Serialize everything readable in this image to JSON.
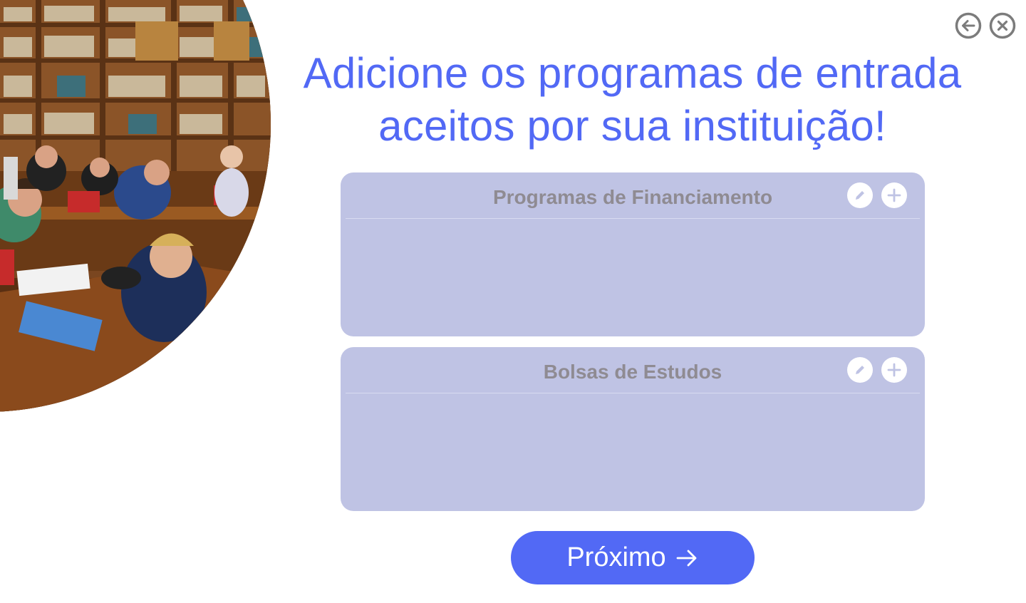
{
  "header": {
    "back_icon": "arrow-left-circle-icon",
    "close_icon": "close-circle-icon"
  },
  "hero_image": {
    "subject": "library-photo"
  },
  "title": {
    "line1": "Adicione os programas de entrada",
    "line2": "aceitos por sua instituição!"
  },
  "panels": [
    {
      "title": "Programas de Financiamento",
      "edit_icon": "pencil-icon",
      "add_icon": "plus-icon",
      "items": []
    },
    {
      "title": "Bolsas de Estudos",
      "edit_icon": "pencil-icon",
      "add_icon": "plus-icon",
      "items": []
    }
  ],
  "next_button": {
    "label": "Próximo",
    "icon": "arrow-right-icon"
  },
  "colors": {
    "accent": "#5269f5",
    "panel_bg": "#bfc3e4",
    "panel_title": "#8f8b92",
    "icon_gray": "#7c7c7c"
  }
}
